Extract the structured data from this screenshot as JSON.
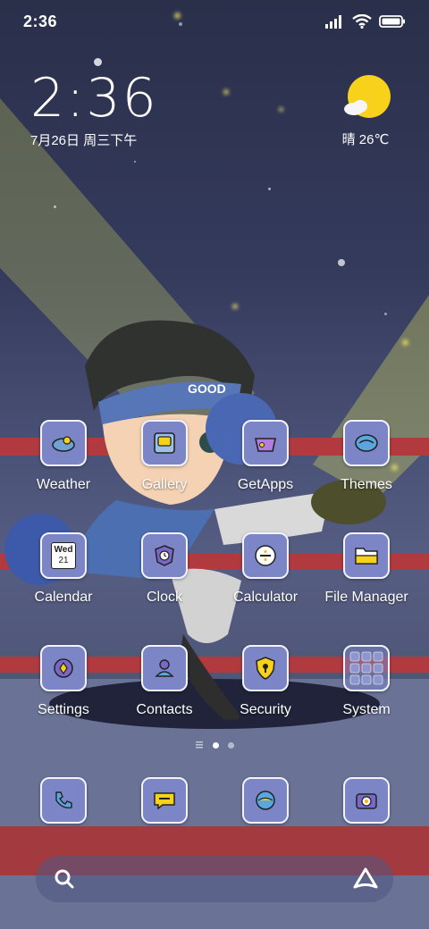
{
  "status_bar": {
    "time": "2:36"
  },
  "clock_widget": {
    "time": "2:36",
    "date": "7月26日 周三下午"
  },
  "weather_widget": {
    "condition": "晴",
    "temperature": "26℃",
    "display": "晴 26℃"
  },
  "apps": [
    {
      "label": "Weather"
    },
    {
      "label": "Gallery"
    },
    {
      "label": "GetApps"
    },
    {
      "label": "Themes"
    },
    {
      "label": "Calendar",
      "icon_text_day": "Wed",
      "icon_text_date": "21"
    },
    {
      "label": "Clock"
    },
    {
      "label": "Calculator"
    },
    {
      "label": "File Manager"
    },
    {
      "label": "Settings"
    },
    {
      "label": "Contacts"
    },
    {
      "label": "Security"
    },
    {
      "label": "System"
    }
  ],
  "dock": [
    {
      "name": "phone-icon"
    },
    {
      "name": "messages-icon"
    },
    {
      "name": "browser-icon"
    },
    {
      "name": "camera-icon"
    }
  ],
  "page_indicator": {
    "total": 2,
    "current": 1
  },
  "search_bar": {
    "left_icon": "search-icon",
    "right_icon": "assistant-icon"
  },
  "colors": {
    "icon_tile": "#7c86c6",
    "icon_border": "#f2f3ff",
    "accent_yellow": "#f8d21a"
  }
}
